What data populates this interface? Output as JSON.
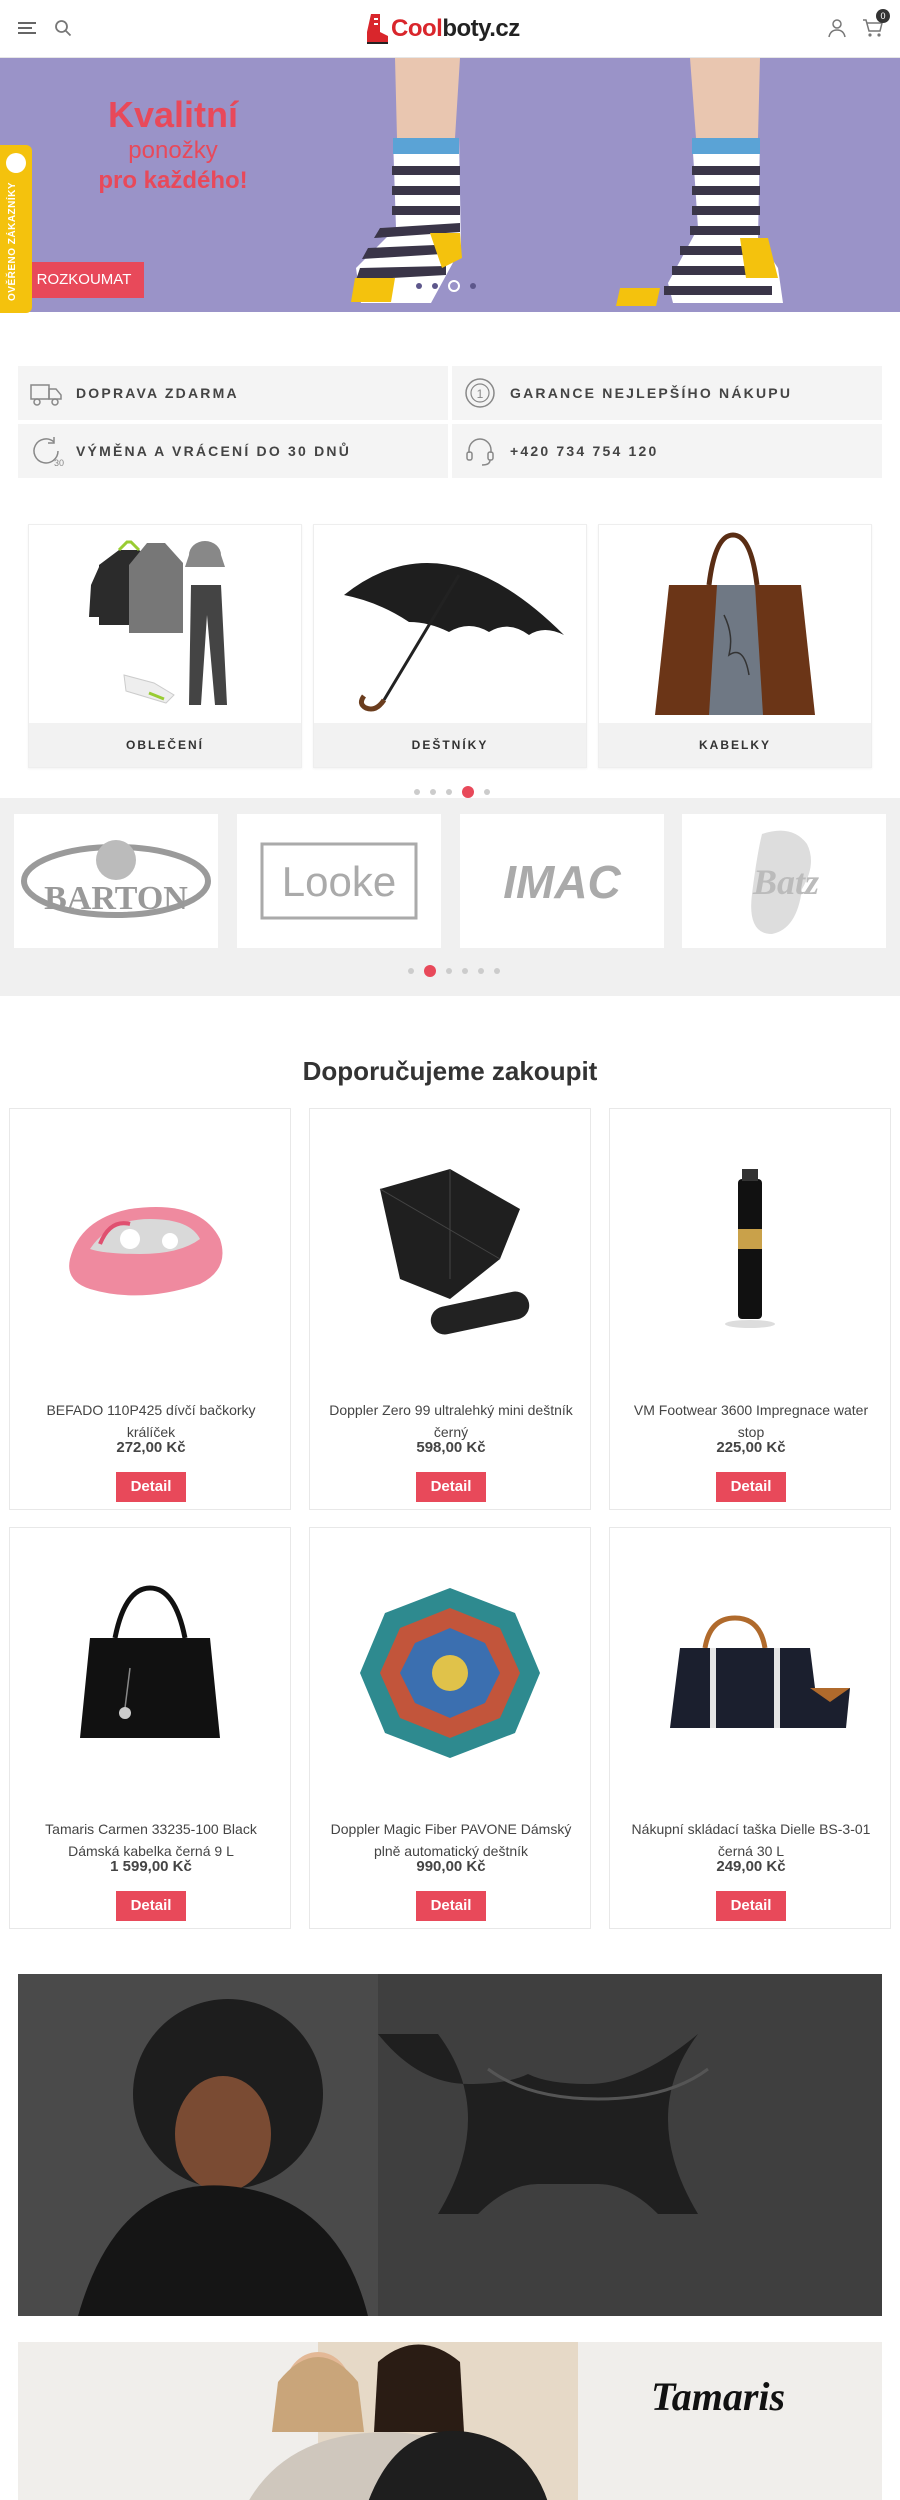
{
  "header": {
    "logo_prefix": "Cool",
    "logo_suffix": "boty.cz",
    "cart_count": "0"
  },
  "hero": {
    "line1": "Kvalitní",
    "line2": "ponožky",
    "line3": "pro každého!",
    "button": "ROZKOUMAT"
  },
  "side_tab": {
    "label": "OVĚŘENO ZÁKAZNÍKY"
  },
  "benefits": [
    {
      "label": "DOPRAVA ZDARMA",
      "icon": "truck-icon"
    },
    {
      "label": "GARANCE NEJLEPŠÍHO NÁKUPU",
      "icon": "medal-icon"
    },
    {
      "label": "VÝMĚNA A VRÁCENÍ DO 30 DNŮ",
      "icon": "return-30-icon"
    },
    {
      "label": "+420 734 754 120",
      "icon": "headset-icon"
    }
  ],
  "categories": [
    {
      "name": "OBLEČENÍ"
    },
    {
      "name": "DEŠTNÍKY"
    },
    {
      "name": "KABELKY"
    }
  ],
  "brands": [
    "BARTON",
    "Looke",
    "IMAC",
    "Batz"
  ],
  "section_title": "Doporučujeme zakoupit",
  "products": [
    {
      "name": "BEFADO 110P425 dívčí bačkorky králíček",
      "price": "272,00 Kč",
      "button": "Detail"
    },
    {
      "name": "Doppler Zero 99 ultralehký mini deštník černý",
      "price": "598,00 Kč",
      "button": "Detail"
    },
    {
      "name": "VM Footwear 3600 Impregnace water stop",
      "price": "225,00 Kč",
      "button": "Detail"
    },
    {
      "name": "Tamaris Carmen 33235-100 Black Dámská kabelka černá 9 L",
      "price": "1 599,00 Kč",
      "button": "Detail"
    },
    {
      "name": "Doppler Magic Fiber PAVONE Dámský plně automatický deštník",
      "price": "990,00 Kč",
      "button": "Detail"
    },
    {
      "name": "Nákupní skládací taška Dielle BS-3-01 černá 30 L",
      "price": "249,00 Kč",
      "button": "Detail"
    }
  ],
  "banners": {
    "tamaris_logo": "Tamaris"
  },
  "colors": {
    "accent": "#e8495a",
    "hero_bg": "#9a93c8",
    "tab": "#f4c20d"
  }
}
